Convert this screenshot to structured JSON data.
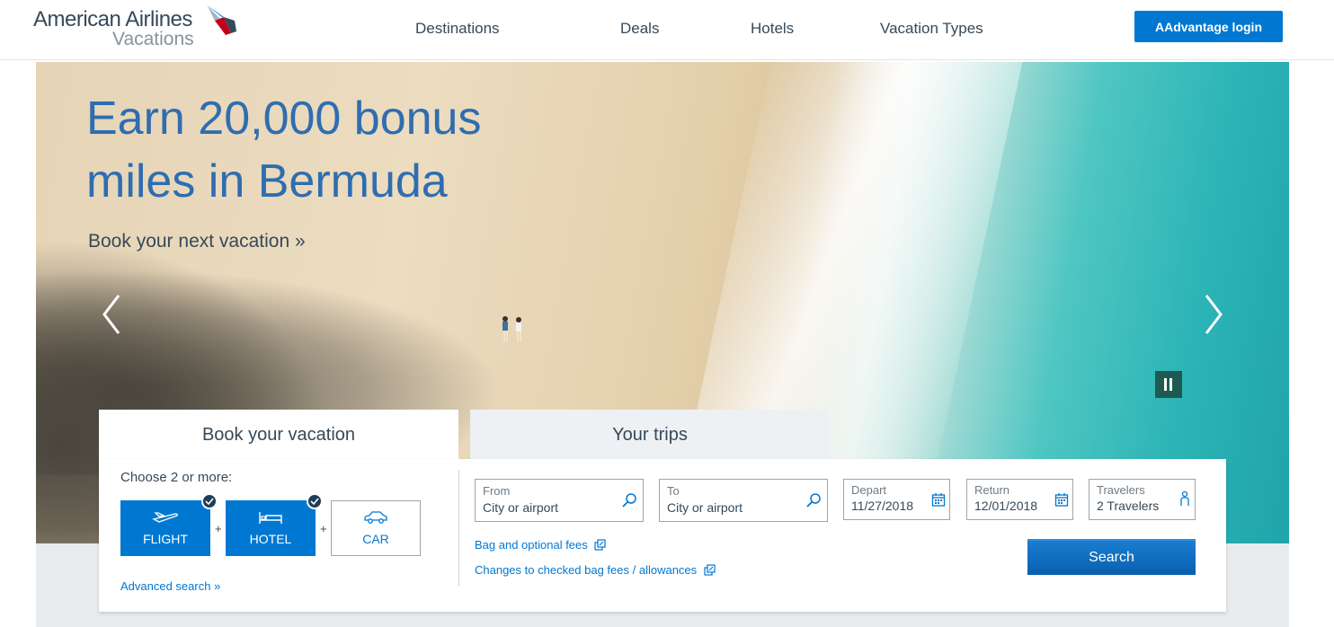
{
  "header": {
    "brand_line1": "American Airlines",
    "brand_line2": "Vacations",
    "nav": [
      "Destinations",
      "Deals",
      "Hotels",
      "Vacation Types"
    ],
    "login_label": "AAdvantage login"
  },
  "hero": {
    "title": "Earn 20,000 bonus miles in Bermuda",
    "link": "Book your next vacation »",
    "prev_icon": "chevron-left-icon",
    "next_icon": "chevron-right-icon",
    "pause_icon": "pause-icon"
  },
  "booking": {
    "tabs": [
      "Book your vacation",
      "Your trips"
    ],
    "choose_label": "Choose 2 or more:",
    "products": [
      {
        "label": "FLIGHT",
        "icon": "plane-icon",
        "selected": true
      },
      {
        "label": "HOTEL",
        "icon": "bed-icon",
        "selected": true
      },
      {
        "label": "CAR",
        "icon": "car-icon",
        "selected": false
      }
    ],
    "plus": "+",
    "advanced_search": "Advanced search »",
    "from": {
      "label": "From",
      "placeholder": "City or airport"
    },
    "to": {
      "label": "To",
      "placeholder": "City or airport"
    },
    "depart": {
      "label": "Depart",
      "value": "11/27/2018"
    },
    "return": {
      "label": "Return",
      "value": "12/01/2018"
    },
    "travelers": {
      "label": "Travelers",
      "value": "2 Travelers"
    },
    "bag_fees_link": "Bag and optional fees",
    "changes_link": "Changes to checked bag fees / allowances",
    "search_label": "Search"
  },
  "colors": {
    "brand_blue": "#0078d2",
    "text_dark": "#36495a",
    "hero_title": "#2f6db0"
  }
}
